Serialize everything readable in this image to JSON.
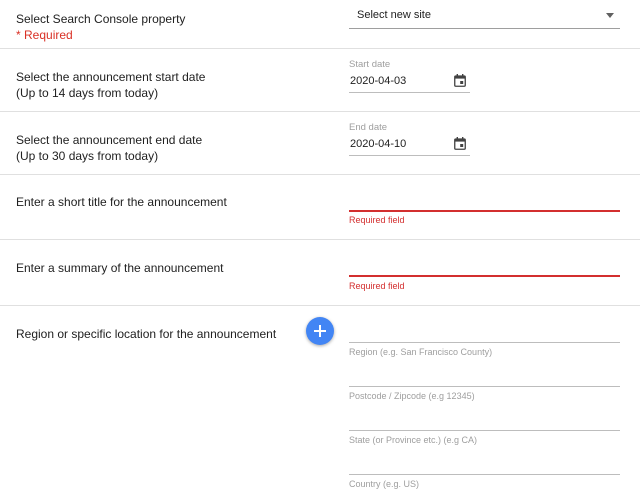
{
  "property": {
    "label": "Select Search Console property",
    "required_note": "* Required",
    "select_value": "Select new site"
  },
  "start_date": {
    "label_line1": "Select the announcement start date",
    "label_line2": "(Up to 14 days from today)",
    "caption": "Start date",
    "value": "2020-04-03",
    "icon": "calendar-icon"
  },
  "end_date": {
    "label_line1": "Select the announcement end date",
    "label_line2": "(Up to 30 days from today)",
    "caption": "End date",
    "value": "2020-04-10",
    "icon": "calendar-icon"
  },
  "title": {
    "label": "Enter a short title for the announcement",
    "error": "Required field"
  },
  "summary": {
    "label": "Enter a summary of the announcement",
    "error": "Required field"
  },
  "location": {
    "label": "Region or specific location for the announcement",
    "add_icon": "plus-icon",
    "region_placeholder": "Region (e.g. San Francisco County)",
    "postcode_placeholder": "Postcode / Zipcode (e.g 12345)",
    "state_placeholder": "State (or Province etc.) (e.g CA)",
    "country_placeholder": "Country (e.g. US)"
  },
  "colors": {
    "error": "#d32f2f",
    "required": "#d93025",
    "accent": "#4285f4"
  }
}
